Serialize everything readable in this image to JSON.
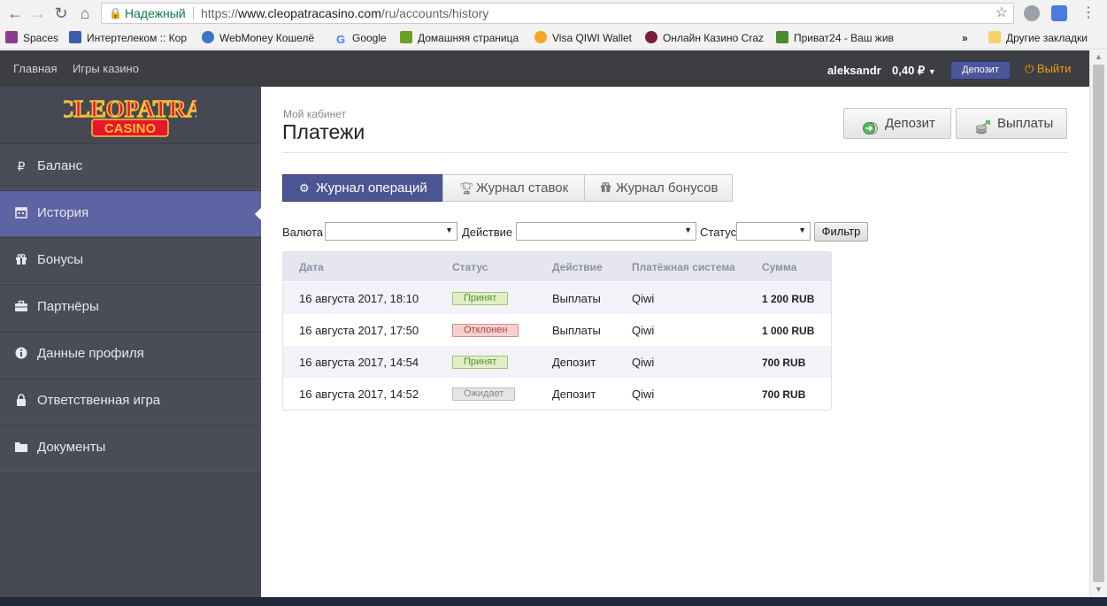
{
  "browser": {
    "secure_label": "Надежный",
    "url_scheme": "https://",
    "url_host": "www.cleopatracasino.com",
    "url_path": "/ru/accounts/history",
    "bookmarks": [
      {
        "label": "Spaces",
        "color": "#8e3b8b"
      },
      {
        "label": "Интертелеком :: Кор",
        "color": "#3a5fa8"
      },
      {
        "label": "WebMoney Кошелё",
        "color": "#3e74c6"
      },
      {
        "label": "Google",
        "color": "#4285f4"
      },
      {
        "label": "Домашняя страница",
        "color": "#6aa121"
      },
      {
        "label": "Visa QIWI Wallet",
        "color": "#f5a623"
      },
      {
        "label": "Онлайн Казино Craz",
        "color": "#7a1f3a"
      },
      {
        "label": "Приват24 - Ваш жив",
        "color": "#4b8b2d"
      }
    ],
    "more_label": "»",
    "other_bookmarks": "Другие закладки"
  },
  "topbar": {
    "nav": [
      "Главная",
      "Игры казино"
    ],
    "username": "aleksandr",
    "balance": "0,40 ₽",
    "deposit": "Депозит",
    "logout": "Выйти"
  },
  "sidebar": {
    "logo_top": "CLEOPATRA",
    "logo_bottom": "CASINO",
    "items": [
      {
        "label": "Баланс",
        "icon": "ruble-icon",
        "active": false
      },
      {
        "label": "История",
        "icon": "calendar-icon",
        "active": true
      },
      {
        "label": "Бонусы",
        "icon": "gift-icon",
        "active": false
      },
      {
        "label": "Партнёры",
        "icon": "briefcase-icon",
        "active": false
      },
      {
        "label": "Данные профиля",
        "icon": "info-icon",
        "active": false
      },
      {
        "label": "Ответственная игра",
        "icon": "lock-icon",
        "active": false
      },
      {
        "label": "Документы",
        "icon": "folder-icon",
        "active": false
      }
    ]
  },
  "main": {
    "subtitle": "Мой кабинет",
    "title": "Платежи",
    "deposit_button": "Депозит",
    "payout_button": "Выплаты",
    "tabs": [
      {
        "label": "Журнал операций",
        "active": true
      },
      {
        "label": "Журнал ставок",
        "active": false
      },
      {
        "label": "Журнал бонусов",
        "active": false
      }
    ],
    "filter": {
      "currency_label": "Валюта",
      "action_label": "Действие",
      "status_label": "Статус",
      "button": "Фильтр"
    },
    "table": {
      "columns": [
        "Дата",
        "Статус",
        "Действие",
        "Платёжная система",
        "Сумма"
      ],
      "rows": [
        {
          "date": "16 августа 2017, 18:10",
          "status": "Принят",
          "status_kind": "ok",
          "action": "Выплаты",
          "system": "Qiwi",
          "amount": "1 200 RUB"
        },
        {
          "date": "16 августа 2017, 17:50",
          "status": "Отклонен",
          "status_kind": "rej",
          "action": "Выплаты",
          "system": "Qiwi",
          "amount": "1 000 RUB"
        },
        {
          "date": "16 августа 2017, 14:54",
          "status": "Принят",
          "status_kind": "ok",
          "action": "Депозит",
          "system": "Qiwi",
          "amount": "700 RUB"
        },
        {
          "date": "16 августа 2017, 14:52",
          "status": "Ожидает",
          "status_kind": "wait",
          "action": "Депозит",
          "system": "Qiwi",
          "amount": "700 RUB"
        }
      ]
    }
  }
}
